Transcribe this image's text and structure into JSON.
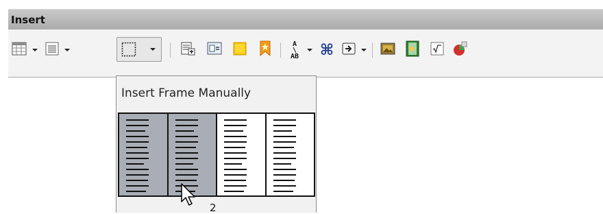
{
  "window": {
    "title": "Insert"
  },
  "toolbar": {
    "buttons": [
      "table-icon",
      "list-icon",
      "frame-icon",
      "caption-icon",
      "field-icon",
      "note-icon",
      "bookmark-icon",
      "fontwork-icon",
      "special-char-icon",
      "hyperlink-icon",
      "image-icon",
      "movie-icon",
      "formula-icon",
      "chart-icon"
    ]
  },
  "dropdown": {
    "title": "Insert Frame Manually",
    "columns_selected": "2",
    "columns_total": 4
  },
  "colors": {
    "titlebar": "#b7b7b7",
    "toolbar_bg": "#f3f3f3",
    "selected_column": "#a9aeb6"
  }
}
